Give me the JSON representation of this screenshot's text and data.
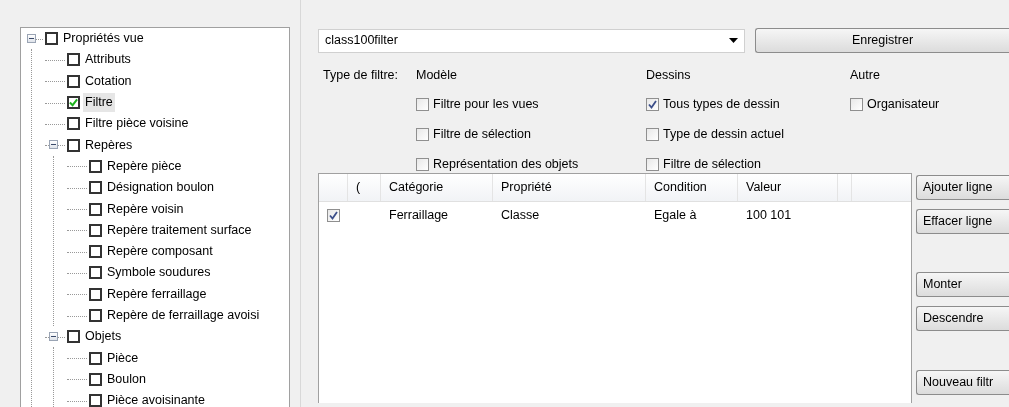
{
  "tree": [
    {
      "label": "Propriétés vue",
      "checked": false,
      "selected": false,
      "expanded": true,
      "children": [
        {
          "label": "Attributs",
          "checked": false,
          "selected": false
        },
        {
          "label": "Cotation",
          "checked": false,
          "selected": false
        },
        {
          "label": "Filtre",
          "checked": true,
          "selected": true
        },
        {
          "label": "Filtre pièce voisine",
          "checked": false,
          "selected": false
        },
        {
          "label": "Repères",
          "checked": false,
          "selected": false,
          "expanded": true,
          "children": [
            {
              "label": "Repère pièce",
              "checked": false,
              "selected": false
            },
            {
              "label": "Désignation boulon",
              "checked": false,
              "selected": false
            },
            {
              "label": "Repère voisin",
              "checked": false,
              "selected": false
            },
            {
              "label": "Repère traitement surface",
              "checked": false,
              "selected": false
            },
            {
              "label": "Repère composant",
              "checked": false,
              "selected": false
            },
            {
              "label": "Symbole soudures",
              "checked": false,
              "selected": false
            },
            {
              "label": "Repère ferraillage",
              "checked": false,
              "selected": false
            },
            {
              "label": "Repère de ferraillage avoisi",
              "checked": false,
              "selected": false
            }
          ]
        },
        {
          "label": "Objets",
          "checked": false,
          "selected": false,
          "expanded": true,
          "children": [
            {
              "label": "Pièce",
              "checked": false,
              "selected": false
            },
            {
              "label": "Boulon",
              "checked": false,
              "selected": false
            },
            {
              "label": "Pièce avoisinante",
              "checked": false,
              "selected": false
            }
          ]
        }
      ]
    }
  ],
  "filter_name": {
    "value": "class100filter"
  },
  "save_button": "Enregistrer",
  "filter_type": {
    "label": "Type de filtre:",
    "groups": [
      {
        "title": "Modèle",
        "options": [
          {
            "label": "Filtre pour les vues",
            "checked": false
          },
          {
            "label": "Filtre de sélection",
            "checked": false
          },
          {
            "label": "Représentation des objets",
            "checked": false
          }
        ]
      },
      {
        "title": "Dessins",
        "options": [
          {
            "label": "Tous types de dessin",
            "checked": true
          },
          {
            "label": "Type de dessin actuel",
            "checked": false
          },
          {
            "label": "Filtre de sélection",
            "checked": false
          }
        ]
      },
      {
        "title": "Autre",
        "options": [
          {
            "label": "Organisateur",
            "checked": false
          }
        ]
      }
    ]
  },
  "table": {
    "columns": [
      "(",
      "Catégorie",
      "Propriété",
      "Condition",
      "Valeur"
    ],
    "rows": [
      {
        "checked": true,
        "cells": [
          "",
          "Ferraillage",
          "Classe",
          "Egale à",
          "100 101"
        ]
      }
    ]
  },
  "side_buttons": [
    "Ajouter ligne",
    "Effacer ligne",
    "Monter",
    "Descendre",
    "Nouveau filtr"
  ]
}
